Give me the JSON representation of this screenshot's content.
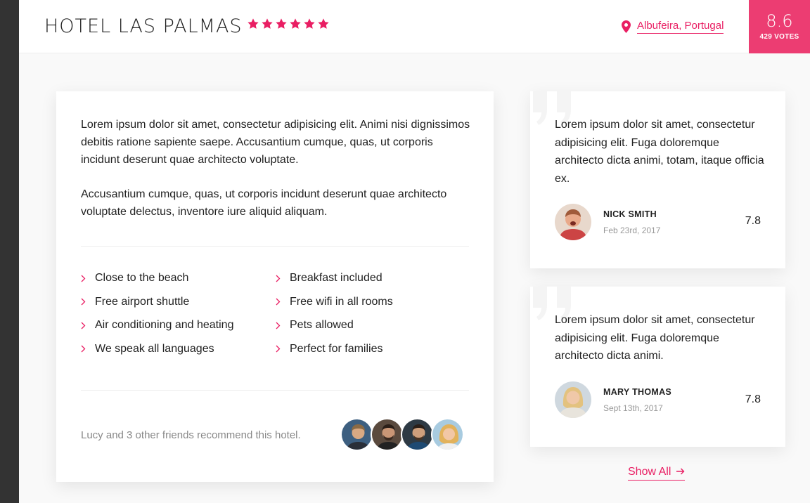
{
  "header": {
    "hotel_name": "HOTEL LAS PALMAS",
    "star_count": 6,
    "location": "Albufeira, Portugal",
    "score": "8.6",
    "votes": "429 VOTES"
  },
  "colors": {
    "accent": "#e91e63",
    "score_bg": "#ec3d72",
    "sidebar_strip": "#333333"
  },
  "icons": {
    "star": "star-icon",
    "location": "map-pin-icon",
    "chevron": "chevron-right-icon",
    "quote": "quote-icon",
    "arrow": "arrow-right-icon"
  },
  "description": {
    "p1": "Lorem ipsum dolor sit amet, consectetur adipisicing elit. Animi nisi dignissimos debitis ratione sapiente saepe. Accusantium cumque, quas, ut corporis incidunt deserunt quae architecto voluptate.",
    "p2": "Accusantium cumque, quas, ut corporis incidunt deserunt quae architecto voluptate delectus, inventore iure aliquid aliquam."
  },
  "features": [
    "Close to the beach",
    "Breakfast included",
    "Free airport shuttle",
    "Free wifi in all rooms",
    "Air conditioning and heating",
    "Pets allowed",
    "We speak all languages",
    "Perfect for families"
  ],
  "recommend_text": "Lucy and 3 other friends recommend this hotel.",
  "reviews": [
    {
      "text": "Lorem ipsum dolor sit amet, consectetur adipisicing elit. Fuga doloremque architecto dicta animi, totam, itaque officia ex.",
      "name": "NICK SMITH",
      "date": "Feb 23rd, 2017",
      "score": "7.8"
    },
    {
      "text": "Lorem ipsum dolor sit amet, consectetur adipisicing elit. Fuga doloremque architecto dicta animi.",
      "name": "MARY THOMAS",
      "date": "Sept 13th, 2017",
      "score": "7.8"
    }
  ],
  "show_all_label": "Show All"
}
